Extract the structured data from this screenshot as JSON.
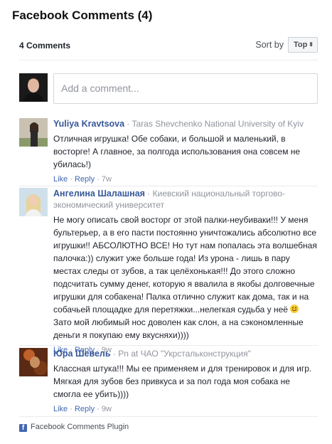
{
  "title": "Facebook Comments (4)",
  "header": {
    "count": "4 Comments",
    "sort_label": "Sort by",
    "sort_value": "Top",
    "sort_caret": "⬍"
  },
  "composer": {
    "placeholder": "Add a comment..."
  },
  "comments": [
    {
      "name": "Yuliya Kravtsova",
      "sep": " · ",
      "affiliation": "Taras Shevchenko National University of Kyiv",
      "text": "Отличная игрушка! Обе собаки, и большой и маленький, в восторге! А главное, за полгода использования она совсем не убилась!)",
      "like": "Like",
      "reply": "Reply",
      "time": "7w"
    },
    {
      "name": "Ангелина Шалашная",
      "sep": " · ",
      "affiliation": "Киевский национальный торгово-экономический университет",
      "text_before": "Не могу описать свой восторг от этой палки-неубиваки!!! У меня бультерьер, а в его пасти постоянно уничтожались абсолютно все игрушки!! АБСОЛЮТНО ВСЕ! Но тут нам попалась эта волшебная палочка:)) служит уже больше года! Из урона - лишь в пару местах следы от зубов, а так целёхонькая!!! До этого сложно подсчитать сумму денег, которую я ввалила в якобы долговечные игрушки для собакена! Палка отлично служит как дома, так и на собачьей площадке для перетяжки...нелегкая судьба у неё ",
      "text_after": " Зато мой любимый нос доволен как слон, а на сэкономленные деньги я покупаю ему вкусняхи))))",
      "like": "Like",
      "reply": "Reply",
      "time": "9w"
    },
    {
      "name": "Юра Шевель",
      "sep": " · ",
      "affiliation": "Pn at ЧАО \"Укрстальконструкция\"",
      "text": "Классная штука!!! Мы ее применяем и для тренировок и для игр. Мягкая для зубов без привкуса и за пол года моя собака не смогла ее убить))))",
      "like": "Like",
      "reply": "Reply",
      "time": "9w"
    }
  ],
  "action_sep": " · ",
  "footer": {
    "icon": "f",
    "label": "Facebook Comments Plugin"
  },
  "icons": {
    "facebook": "facebook-icon",
    "smiley": "smiley-icon",
    "sort_caret": "chevron-updown-icon"
  },
  "colors": {
    "link": "#365899",
    "action": "#4267b2",
    "muted": "#90949c",
    "divider": "#e9ebee",
    "brand": "#4267b2"
  }
}
